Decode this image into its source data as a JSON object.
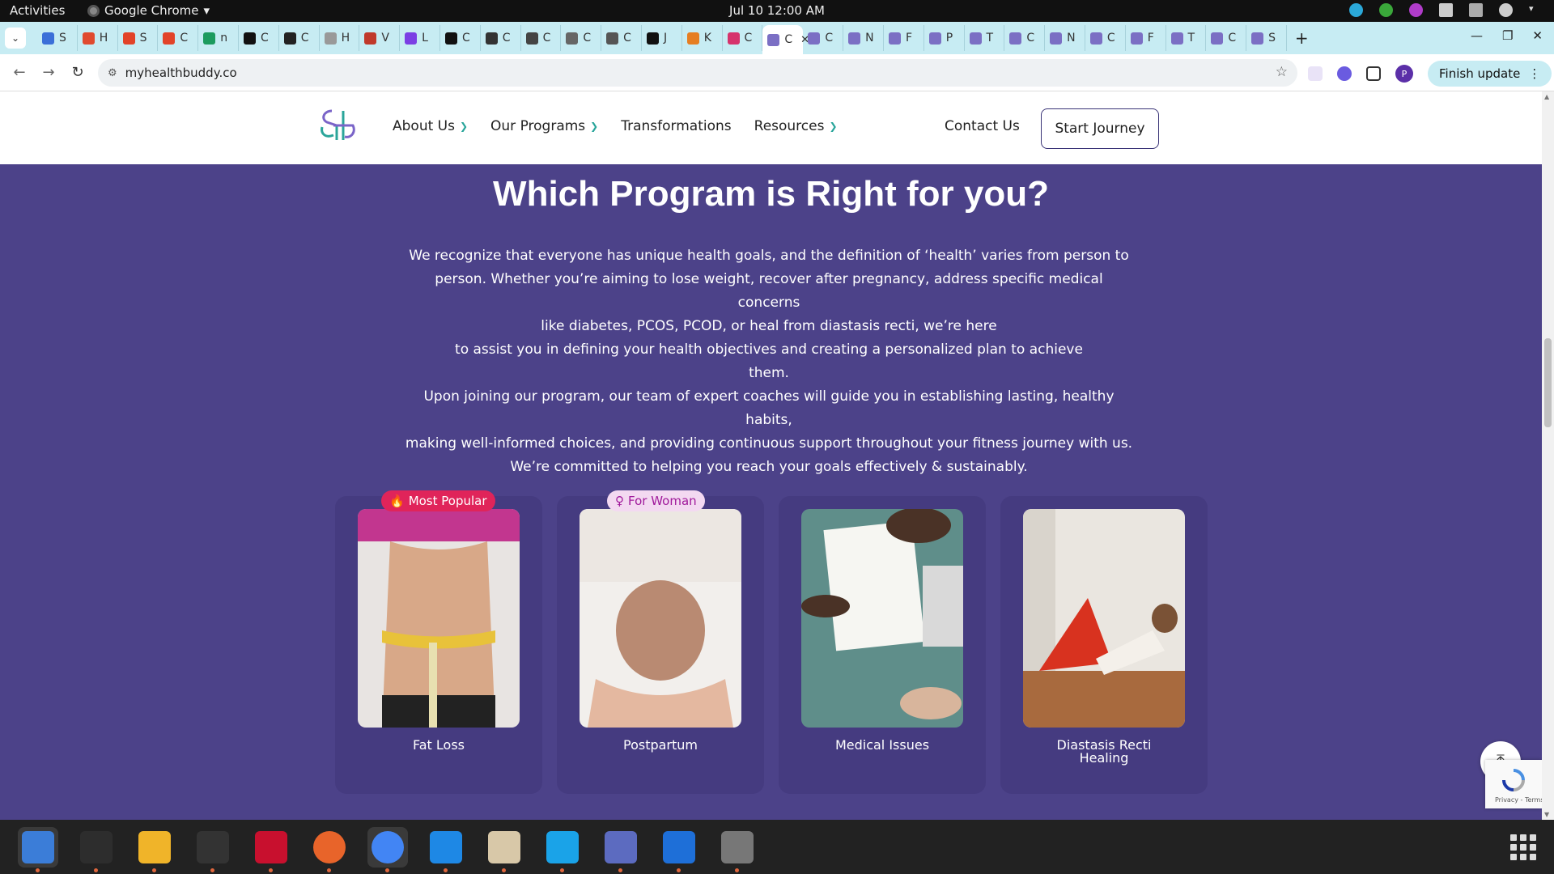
{
  "topbar": {
    "activities": "Activities",
    "app_name": "Google Chrome",
    "clock": "Jul 10  12:00 AM"
  },
  "tabs": [
    {
      "letter": "S",
      "color": "#3b6fd8"
    },
    {
      "letter": "H",
      "color": "#e04a2f"
    },
    {
      "letter": "S",
      "color": "#e24329"
    },
    {
      "letter": "C",
      "color": "#e24329"
    },
    {
      "letter": "n",
      "color": "#1c9b5e"
    },
    {
      "letter": "C",
      "color": "#111111"
    },
    {
      "letter": "C",
      "color": "#222222"
    },
    {
      "letter": "H",
      "color": "#999999"
    },
    {
      "letter": "V",
      "color": "#c0392b"
    },
    {
      "letter": "L",
      "color": "#7b3fe4"
    },
    {
      "letter": "C",
      "color": "#111111"
    },
    {
      "letter": "C",
      "color": "#333333"
    },
    {
      "letter": "C",
      "color": "#444444"
    },
    {
      "letter": "C",
      "color": "#666666"
    },
    {
      "letter": "C",
      "color": "#555555"
    },
    {
      "letter": "J",
      "color": "#111111"
    },
    {
      "letter": "K",
      "color": "#e67e22"
    },
    {
      "letter": "C",
      "color": "#d6336c"
    },
    {
      "letter": "C",
      "color": "#7b6fc4",
      "active": true
    },
    {
      "letter": "C",
      "color": "#7b6fc4"
    },
    {
      "letter": "N",
      "color": "#7b6fc4"
    },
    {
      "letter": "F",
      "color": "#7b6fc4"
    },
    {
      "letter": "P",
      "color": "#7b6fc4"
    },
    {
      "letter": "T",
      "color": "#7b6fc4"
    },
    {
      "letter": "C",
      "color": "#7b6fc4"
    },
    {
      "letter": "N",
      "color": "#7b6fc4"
    },
    {
      "letter": "C",
      "color": "#7b6fc4"
    },
    {
      "letter": "F",
      "color": "#7b6fc4"
    },
    {
      "letter": "T",
      "color": "#7b6fc4"
    },
    {
      "letter": "C",
      "color": "#7b6fc4"
    },
    {
      "letter": "S",
      "color": "#7b6fc4"
    }
  ],
  "toolbar": {
    "url": "myhealthbuddy.co",
    "finish_update": "Finish update",
    "profile_initial": "P"
  },
  "site": {
    "nav": {
      "about": "About Us",
      "programs": "Our Programs",
      "transformations": "Transformations",
      "resources": "Resources",
      "contact": "Contact Us",
      "cta": "Start Journey"
    },
    "title": "Which Program is Right for you?",
    "paragraph1_lines": [
      "We recognize that everyone has unique health goals, and the definition of ‘health’ varies from person to",
      "person. Whether you’re aiming to lose weight, recover after pregnancy, address specific medical concerns",
      "like diabetes, PCOS, PCOD, or heal from diastasis recti, we’re here",
      "to assist you in defining your health objectives and creating a personalized plan to achieve",
      "them."
    ],
    "paragraph2_lines": [
      "Upon joining our program, our team of expert coaches will guide you in establishing lasting, healthy habits,",
      "making well-informed choices, and providing continuous support throughout your fitness journey with us.",
      "We’re committed to helping you reach your goals effectively & sustainably."
    ],
    "cards": [
      {
        "label": "Fat Loss",
        "badge": "Most Popular"
      },
      {
        "label": "Postpartum",
        "badge": "For Woman"
      },
      {
        "label": "Medical Issues"
      },
      {
        "label_line1": "Diastasis Recti",
        "label_line2": "Healing"
      }
    ],
    "recaptcha": "Privacy - Terms"
  },
  "colors": {
    "page_bg": "#4c4289",
    "card_bg": "#453b80",
    "accent_teal": "#28a59a",
    "badge_popular": "#e0245a",
    "badge_woman_bg": "#f3d9f1"
  },
  "dock": [
    {
      "name": "thunderbird-icon"
    },
    {
      "name": "terminal-icon"
    },
    {
      "name": "calculator-icon"
    },
    {
      "name": "system-monitor-icon"
    },
    {
      "name": "filezilla-icon"
    },
    {
      "name": "firefox-icon"
    },
    {
      "name": "chrome-icon"
    },
    {
      "name": "vscode-icon"
    },
    {
      "name": "files-icon"
    },
    {
      "name": "skype-icon"
    },
    {
      "name": "text-editor-icon"
    },
    {
      "name": "document-viewer-icon"
    },
    {
      "name": "disk-utility-icon"
    }
  ]
}
